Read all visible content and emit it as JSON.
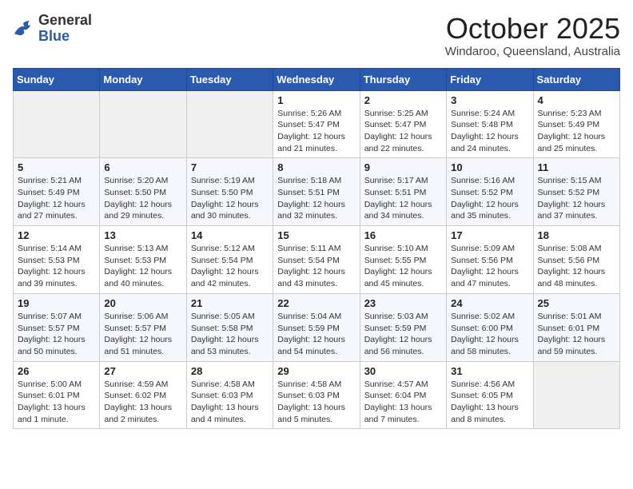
{
  "header": {
    "logo_general": "General",
    "logo_blue": "Blue",
    "month_title": "October 2025",
    "subtitle": "Windaroo, Queensland, Australia"
  },
  "days_of_week": [
    "Sunday",
    "Monday",
    "Tuesday",
    "Wednesday",
    "Thursday",
    "Friday",
    "Saturday"
  ],
  "weeks": [
    [
      {
        "day": "",
        "info": ""
      },
      {
        "day": "",
        "info": ""
      },
      {
        "day": "",
        "info": ""
      },
      {
        "day": "1",
        "info": "Sunrise: 5:26 AM\nSunset: 5:47 PM\nDaylight: 12 hours\nand 21 minutes."
      },
      {
        "day": "2",
        "info": "Sunrise: 5:25 AM\nSunset: 5:47 PM\nDaylight: 12 hours\nand 22 minutes."
      },
      {
        "day": "3",
        "info": "Sunrise: 5:24 AM\nSunset: 5:48 PM\nDaylight: 12 hours\nand 24 minutes."
      },
      {
        "day": "4",
        "info": "Sunrise: 5:23 AM\nSunset: 5:49 PM\nDaylight: 12 hours\nand 25 minutes."
      }
    ],
    [
      {
        "day": "5",
        "info": "Sunrise: 5:21 AM\nSunset: 5:49 PM\nDaylight: 12 hours\nand 27 minutes."
      },
      {
        "day": "6",
        "info": "Sunrise: 5:20 AM\nSunset: 5:50 PM\nDaylight: 12 hours\nand 29 minutes."
      },
      {
        "day": "7",
        "info": "Sunrise: 5:19 AM\nSunset: 5:50 PM\nDaylight: 12 hours\nand 30 minutes."
      },
      {
        "day": "8",
        "info": "Sunrise: 5:18 AM\nSunset: 5:51 PM\nDaylight: 12 hours\nand 32 minutes."
      },
      {
        "day": "9",
        "info": "Sunrise: 5:17 AM\nSunset: 5:51 PM\nDaylight: 12 hours\nand 34 minutes."
      },
      {
        "day": "10",
        "info": "Sunrise: 5:16 AM\nSunset: 5:52 PM\nDaylight: 12 hours\nand 35 minutes."
      },
      {
        "day": "11",
        "info": "Sunrise: 5:15 AM\nSunset: 5:52 PM\nDaylight: 12 hours\nand 37 minutes."
      }
    ],
    [
      {
        "day": "12",
        "info": "Sunrise: 5:14 AM\nSunset: 5:53 PM\nDaylight: 12 hours\nand 39 minutes."
      },
      {
        "day": "13",
        "info": "Sunrise: 5:13 AM\nSunset: 5:53 PM\nDaylight: 12 hours\nand 40 minutes."
      },
      {
        "day": "14",
        "info": "Sunrise: 5:12 AM\nSunset: 5:54 PM\nDaylight: 12 hours\nand 42 minutes."
      },
      {
        "day": "15",
        "info": "Sunrise: 5:11 AM\nSunset: 5:54 PM\nDaylight: 12 hours\nand 43 minutes."
      },
      {
        "day": "16",
        "info": "Sunrise: 5:10 AM\nSunset: 5:55 PM\nDaylight: 12 hours\nand 45 minutes."
      },
      {
        "day": "17",
        "info": "Sunrise: 5:09 AM\nSunset: 5:56 PM\nDaylight: 12 hours\nand 47 minutes."
      },
      {
        "day": "18",
        "info": "Sunrise: 5:08 AM\nSunset: 5:56 PM\nDaylight: 12 hours\nand 48 minutes."
      }
    ],
    [
      {
        "day": "19",
        "info": "Sunrise: 5:07 AM\nSunset: 5:57 PM\nDaylight: 12 hours\nand 50 minutes."
      },
      {
        "day": "20",
        "info": "Sunrise: 5:06 AM\nSunset: 5:57 PM\nDaylight: 12 hours\nand 51 minutes."
      },
      {
        "day": "21",
        "info": "Sunrise: 5:05 AM\nSunset: 5:58 PM\nDaylight: 12 hours\nand 53 minutes."
      },
      {
        "day": "22",
        "info": "Sunrise: 5:04 AM\nSunset: 5:59 PM\nDaylight: 12 hours\nand 54 minutes."
      },
      {
        "day": "23",
        "info": "Sunrise: 5:03 AM\nSunset: 5:59 PM\nDaylight: 12 hours\nand 56 minutes."
      },
      {
        "day": "24",
        "info": "Sunrise: 5:02 AM\nSunset: 6:00 PM\nDaylight: 12 hours\nand 58 minutes."
      },
      {
        "day": "25",
        "info": "Sunrise: 5:01 AM\nSunset: 6:01 PM\nDaylight: 12 hours\nand 59 minutes."
      }
    ],
    [
      {
        "day": "26",
        "info": "Sunrise: 5:00 AM\nSunset: 6:01 PM\nDaylight: 13 hours\nand 1 minute."
      },
      {
        "day": "27",
        "info": "Sunrise: 4:59 AM\nSunset: 6:02 PM\nDaylight: 13 hours\nand 2 minutes."
      },
      {
        "day": "28",
        "info": "Sunrise: 4:58 AM\nSunset: 6:03 PM\nDaylight: 13 hours\nand 4 minutes."
      },
      {
        "day": "29",
        "info": "Sunrise: 4:58 AM\nSunset: 6:03 PM\nDaylight: 13 hours\nand 5 minutes."
      },
      {
        "day": "30",
        "info": "Sunrise: 4:57 AM\nSunset: 6:04 PM\nDaylight: 13 hours\nand 7 minutes."
      },
      {
        "day": "31",
        "info": "Sunrise: 4:56 AM\nSunset: 6:05 PM\nDaylight: 13 hours\nand 8 minutes."
      },
      {
        "day": "",
        "info": ""
      }
    ]
  ]
}
